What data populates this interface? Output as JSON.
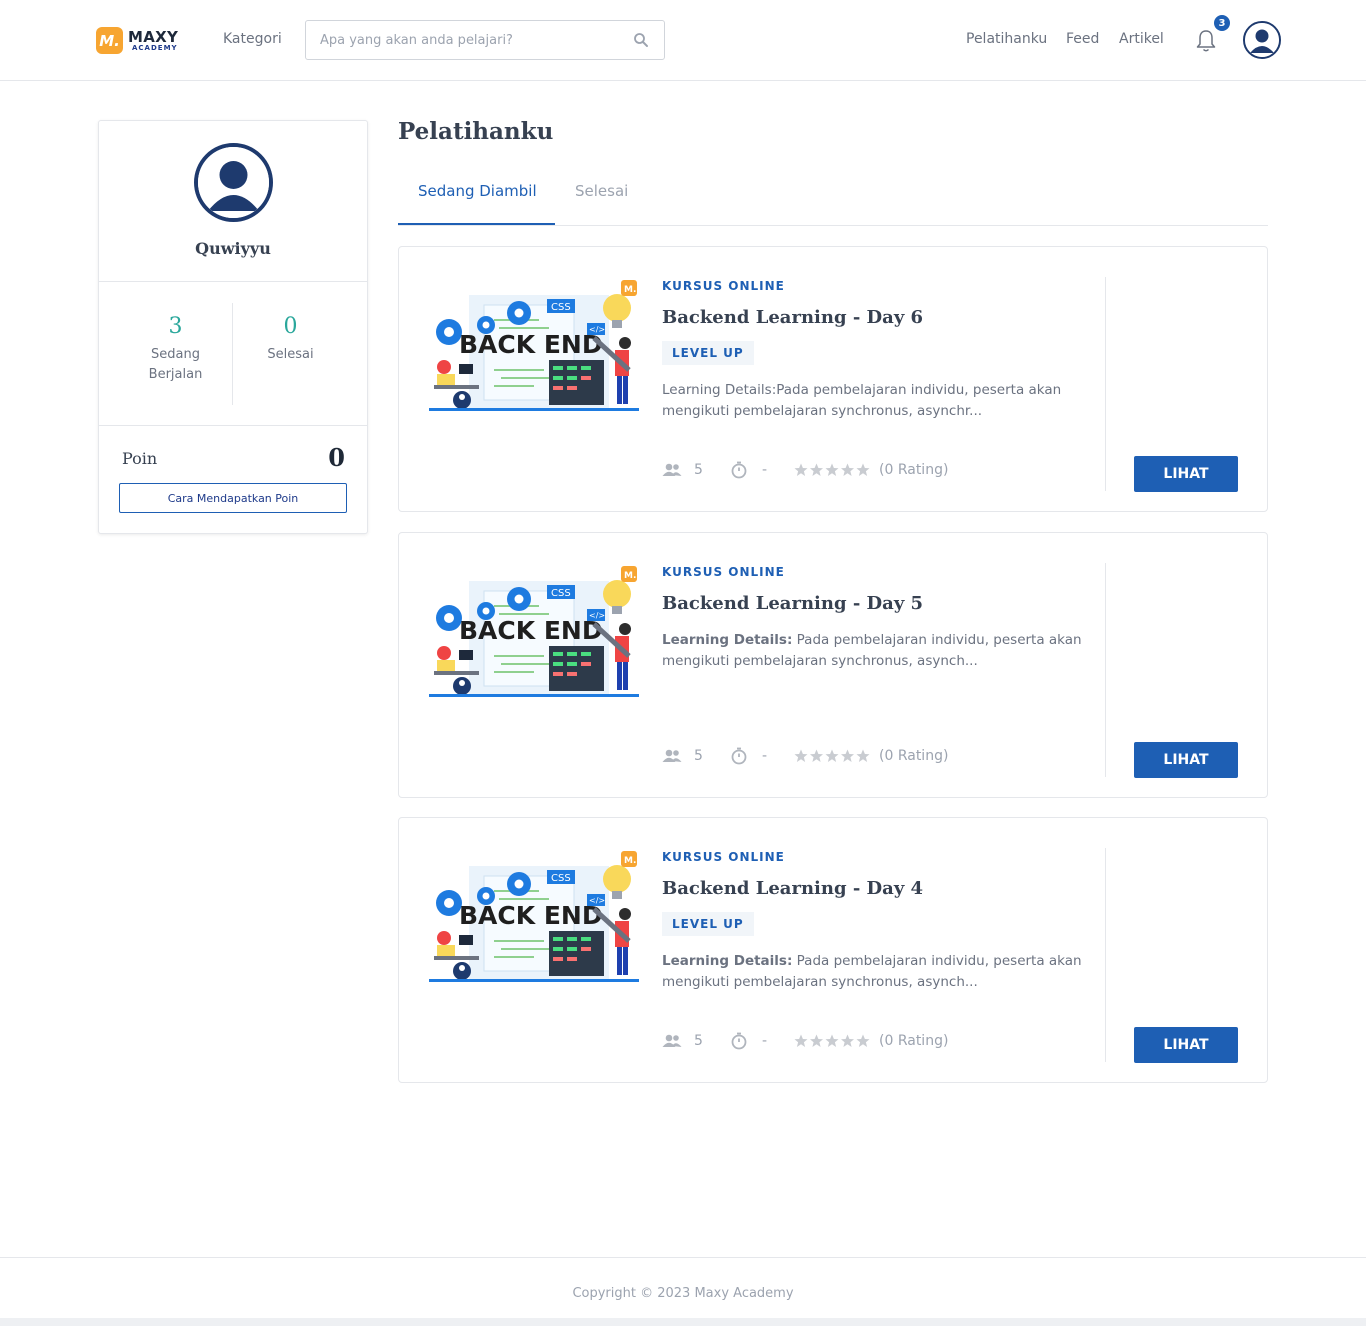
{
  "header": {
    "logo_mark": "M.",
    "logo_line1": "MAXY",
    "logo_line2": "ACADEMY",
    "kategori": "Kategori",
    "search_placeholder": "Apa yang akan anda pelajari?",
    "nav": [
      "Pelatihanku",
      "Feed",
      "Artikel"
    ],
    "notification_count": "3"
  },
  "profile": {
    "name": "Quwiyyu",
    "stats": [
      {
        "value": "3",
        "label_line1": "Sedang",
        "label_line2": "Berjalan"
      },
      {
        "value": "0",
        "label_line1": "Selesai",
        "label_line2": ""
      }
    ],
    "poin_label": "Poin",
    "poin_value": "0",
    "poin_button": "Cara Mendapatkan Poin"
  },
  "main": {
    "title": "Pelatihanku",
    "tabs": [
      "Sedang Diambil",
      "Selesai"
    ],
    "thumb_text": "BACK END",
    "courses": [
      {
        "type": "KURSUS ONLINE",
        "title": "Backend Learning - Day 6",
        "tag": "LEVEL UP",
        "desc_bold": "",
        "desc": "Learning Details:Pada pembelajaran individu, peserta akan mengikuti pembelajaran synchronus, asynchr...",
        "participants": "5",
        "duration": "-",
        "rating": "(0 Rating)",
        "button": "LIHAT"
      },
      {
        "type": "KURSUS ONLINE",
        "title": "Backend Learning - Day 5",
        "tag": "",
        "desc_bold": "Learning Details:",
        "desc": " Pada pembelajaran individu, peserta akan mengikuti pembelajaran synchronus, asynch...",
        "participants": "5",
        "duration": "-",
        "rating": "(0 Rating)",
        "button": "LIHAT"
      },
      {
        "type": "KURSUS ONLINE",
        "title": "Backend Learning - Day 4",
        "tag": "LEVEL UP",
        "desc_bold": "Learning Details:",
        "desc": " Pada pembelajaran individu, peserta akan mengikuti pembelajaran synchronus, asynch...",
        "participants": "5",
        "duration": "-",
        "rating": "(0 Rating)",
        "button": "LIHAT"
      }
    ]
  },
  "footer": {
    "copyright": "Copyright © 2023 Maxy Academy"
  },
  "colors": {
    "primary": "#1e5fb4",
    "accent_orange": "#f7a531",
    "stat_teal": "#2aa79b"
  }
}
